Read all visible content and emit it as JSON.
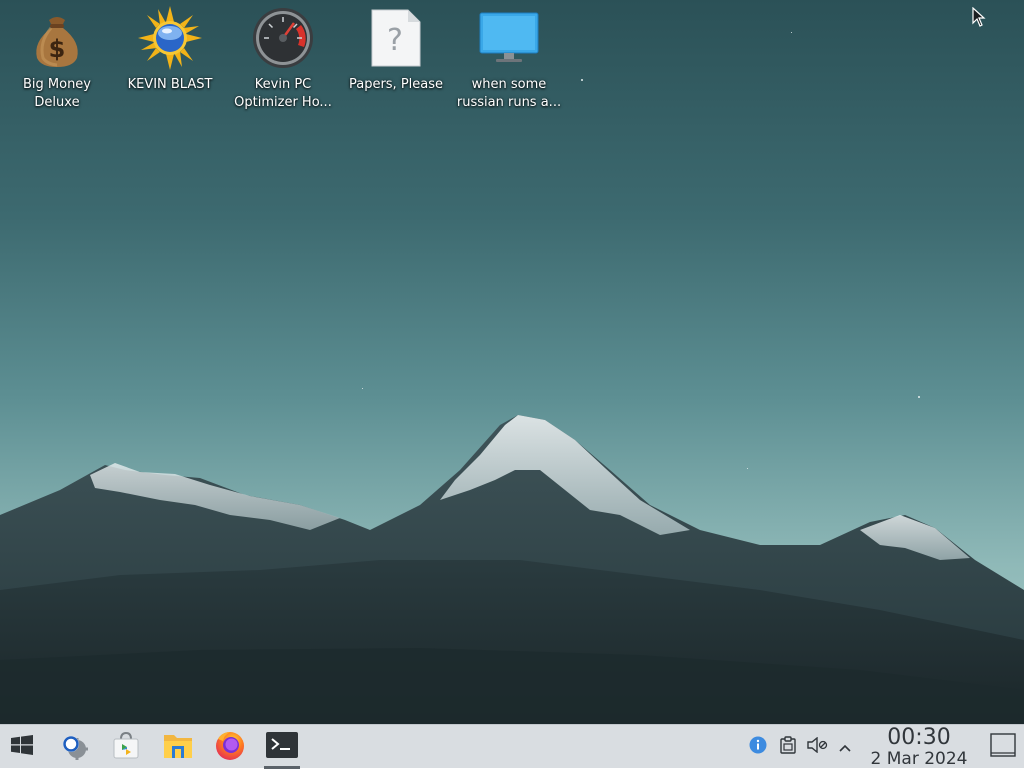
{
  "desktop": {
    "icons": [
      {
        "label": "Big Money Deluxe",
        "icon": "money-bag-icon"
      },
      {
        "label": "KEVIN BLAST",
        "icon": "sun-globe-icon"
      },
      {
        "label": "Kevin PC Optimizer Ho...",
        "icon": "speedometer-icon"
      },
      {
        "label": "Papers, Please",
        "icon": "unknown-file-icon"
      },
      {
        "label": "when some russian runs a...",
        "icon": "monitor-icon"
      }
    ]
  },
  "taskbar": {
    "items": [
      {
        "name": "start-menu",
        "icon": "windows-logo-icon"
      },
      {
        "name": "search",
        "icon": "search-gear-icon"
      },
      {
        "name": "store",
        "icon": "store-bag-icon"
      },
      {
        "name": "file-explorer",
        "icon": "folder-icon"
      },
      {
        "name": "firefox",
        "icon": "firefox-icon"
      },
      {
        "name": "terminal",
        "icon": "terminal-icon",
        "active": true
      }
    ],
    "tray": [
      {
        "name": "updates",
        "icon": "info-icon"
      },
      {
        "name": "clipboard",
        "icon": "clipboard-icon"
      },
      {
        "name": "volume",
        "icon": "volume-muted-icon"
      },
      {
        "name": "expand-tray",
        "icon": "chevron-up-icon"
      }
    ],
    "clock": {
      "time": "00:30",
      "date": "2 Mar 2024"
    },
    "show_desktop": {
      "icon": "show-desktop-icon"
    }
  },
  "colors": {
    "taskbar_bg": "#d9dde1",
    "accent": "#3d8be0",
    "sky_top": "#2b5157",
    "sky_bottom": "#a9cdca"
  }
}
